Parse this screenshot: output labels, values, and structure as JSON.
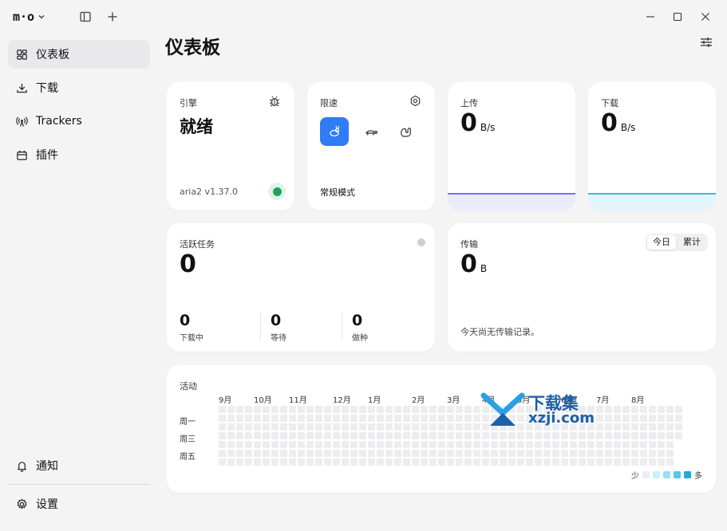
{
  "app": {
    "logo_text": "m·o",
    "page_title": "仪表板"
  },
  "sidebar": {
    "items": [
      {
        "label": "仪表板",
        "icon": "dashboard-icon",
        "active": true
      },
      {
        "label": "下载",
        "icon": "download-icon"
      },
      {
        "label": "Trackers",
        "icon": "antenna-icon"
      },
      {
        "label": "插件",
        "icon": "plugin-icon"
      }
    ],
    "bottom": [
      {
        "label": "通知",
        "icon": "bell-icon"
      },
      {
        "label": "设置",
        "icon": "gear-icon"
      }
    ]
  },
  "engine": {
    "label": "引擎",
    "status": "就绪",
    "version": "aria2 v1.37.0",
    "status_color": "#22a35a"
  },
  "limit": {
    "label": "限速",
    "mode_text": "常规模式",
    "modes": [
      "rabbit-icon",
      "turtle-icon",
      "squirrel-icon"
    ],
    "active_mode": 0
  },
  "upload": {
    "label": "上传",
    "value": "0",
    "unit": "B/s",
    "color": "#7b6cf6"
  },
  "download": {
    "label": "下载",
    "value": "0",
    "unit": "B/s",
    "color": "#3fb6e6"
  },
  "tasks": {
    "label": "活跃任务",
    "value": "0",
    "downloading_value": "0",
    "downloading_label": "下载中",
    "waiting_value": "0",
    "waiting_label": "等待",
    "seeding_value": "0",
    "seeding_label": "做种"
  },
  "transfer": {
    "label": "传输",
    "value": "0",
    "unit": "B",
    "tab_today": "今日",
    "tab_total": "累计",
    "empty_text": "今天尚无传输记录。"
  },
  "activity": {
    "label": "活动",
    "months": [
      "9月",
      "10月",
      "11月",
      "12月",
      "1月",
      "2月",
      "3月",
      "4月",
      "5月",
      "6月",
      "7月",
      "8月"
    ],
    "weekdays": [
      "周一",
      "周三",
      "周五"
    ],
    "legend_less": "少",
    "legend_more": "多",
    "legend_colors": [
      "#ededef",
      "#cdeefa",
      "#9ddcf3",
      "#5cc5ec",
      "#22a7e0"
    ]
  },
  "watermark": {
    "text": "下载集",
    "sub": "xzji.com"
  }
}
